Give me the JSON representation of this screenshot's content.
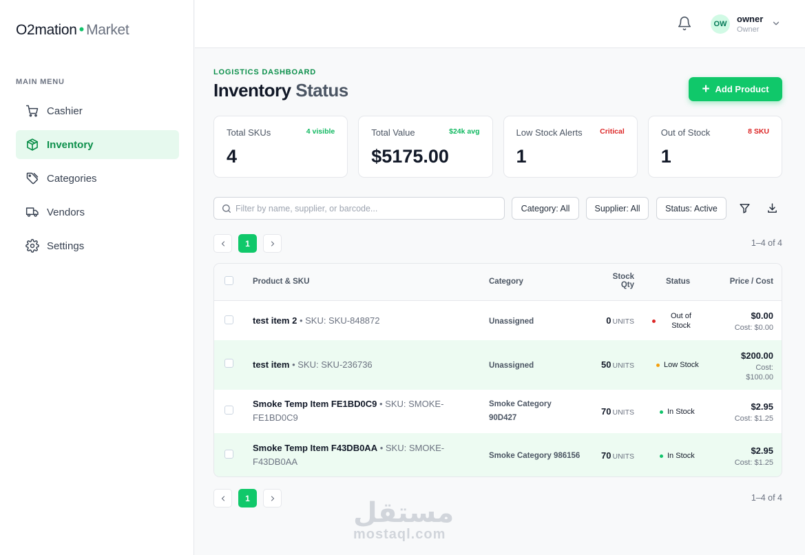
{
  "brand": {
    "name": "O2mation",
    "separator": "•",
    "suffix": "Market"
  },
  "sidebar": {
    "heading": "MAIN MENU",
    "items": [
      {
        "label": "Cashier",
        "icon": "cart-icon",
        "active": false
      },
      {
        "label": "Inventory",
        "icon": "box-icon",
        "active": true
      },
      {
        "label": "Categories",
        "icon": "tag-icon",
        "active": false
      },
      {
        "label": "Vendors",
        "icon": "truck-icon",
        "active": false
      },
      {
        "label": "Settings",
        "icon": "gear-icon",
        "active": false
      }
    ]
  },
  "topbar": {
    "avatar_initials": "OW",
    "user_name": "owner",
    "user_role": "Owner"
  },
  "header": {
    "eyebrow": "LOGISTICS DASHBOARD",
    "title_bold": "Inventory",
    "title_light": "Status",
    "add_button": "Add Product"
  },
  "stats": [
    {
      "label": "Total SKUs",
      "badge": "4 visible",
      "badge_color": "#10b860",
      "value": "4"
    },
    {
      "label": "Total Value",
      "badge": "$24k avg",
      "badge_color": "#10b860",
      "value": "$5175.00"
    },
    {
      "label": "Low Stock Alerts",
      "badge": "Critical",
      "badge_color": "#dc2626",
      "value": "1"
    },
    {
      "label": "Out of Stock",
      "badge": "8 SKU",
      "badge_color": "#dc2626",
      "value": "1"
    }
  ],
  "filters": {
    "search_placeholder": "Filter by name, supplier, or barcode...",
    "category": "Category: All",
    "supplier": "Supplier: All",
    "status": "Status: Active"
  },
  "pagination": {
    "current": "1",
    "range": "1–4 of 4"
  },
  "table": {
    "columns": {
      "product": "Product & SKU",
      "category": "Category",
      "stock_line1": "Stock",
      "stock_line2": "Qty",
      "status": "Status",
      "price": "Price / Cost"
    },
    "rows": [
      {
        "name": "test item 2",
        "sku": "• SKU: SKU-848872",
        "category": "Unassigned",
        "qty": "0",
        "units": "UNITS",
        "status_line1": "Out of",
        "status_line2": "Stock",
        "status_color": "#dc2626",
        "price": "$0.00",
        "cost": "Cost: $0.00"
      },
      {
        "name": "test item",
        "sku": "• SKU: SKU-236736",
        "category": "Unassigned",
        "qty": "50",
        "units": "UNITS",
        "status_line1": "Low Stock",
        "status_line2": "",
        "status_color": "#f59e0b",
        "price": "$200.00",
        "cost_line1": "Cost:",
        "cost_line2": "$100.00"
      },
      {
        "name": "Smoke Temp Item FE1BD0C9",
        "sku": "• SKU: SMOKE-",
        "sku_line2": "FE1BD0C9",
        "category_line1": "Smoke Category",
        "category_line2": "90D427",
        "qty": "70",
        "units": "UNITS",
        "status_line1": "In Stock",
        "status_color": "#10c36a",
        "price": "$2.95",
        "cost": "Cost: $1.25"
      },
      {
        "name": "Smoke Temp Item F43DB0AA",
        "sku": "• SKU: SMOKE-",
        "sku_line2": "F43DB0AA",
        "category": "Smoke Category 986156",
        "qty": "70",
        "units": "UNITS",
        "status_line1": "In Stock",
        "status_color": "#10c36a",
        "price": "$2.95",
        "cost": "Cost: $1.25"
      }
    ]
  },
  "watermark": {
    "arabic": "مستقل",
    "latin": "mostaql.com"
  }
}
